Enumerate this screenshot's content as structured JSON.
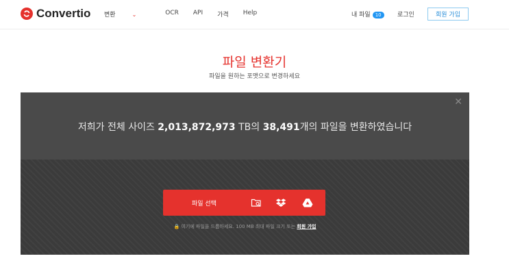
{
  "app": {
    "brand": "Convertio"
  },
  "nav": {
    "items": [
      {
        "label": "변환",
        "has_dropdown": true
      },
      {
        "label": "OCR"
      },
      {
        "label": "API"
      },
      {
        "label": "가격"
      },
      {
        "label": "Help"
      }
    ]
  },
  "header": {
    "my_files_label": "내 파일",
    "my_files_count": "10",
    "login_label": "로그인",
    "signup_label": "회원 가입"
  },
  "hero": {
    "title": "파일 변환기",
    "subtitle": "파일을 원하는 포맷으로 변경하세요"
  },
  "stats": {
    "prefix": "저희가 전체 사이즈 ",
    "size_value": "2,013,872,973",
    "size_unit": " TB의 ",
    "file_count": "38,491",
    "suffix": "개의 파일을 변환하였습니다"
  },
  "upload": {
    "choose_label": "파일 선택",
    "icons": [
      "folder-search-icon",
      "dropbox-icon",
      "google-drive-icon"
    ],
    "hint_text": "여기에 파일을 드롭하세요. 100 MB 최대 파일 크기 또는",
    "hint_link": "회원 가입"
  },
  "colors": {
    "accent": "#e5322d",
    "panel": "#3b3b3b",
    "badge": "#2196f3"
  }
}
